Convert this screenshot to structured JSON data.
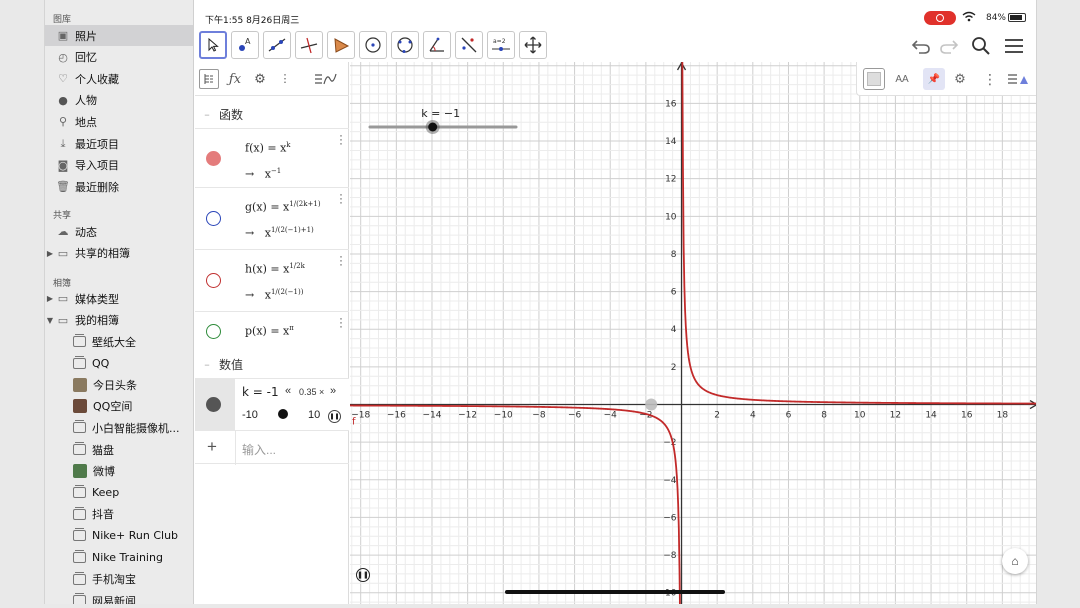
{
  "sidebar": {
    "sections": [
      {
        "title": "图库",
        "items": [
          {
            "label": "照片",
            "icon": "photos-icon",
            "active": true
          },
          {
            "label": "回忆",
            "icon": "memories-icon"
          },
          {
            "label": "个人收藏",
            "icon": "heart-icon"
          },
          {
            "label": "人物",
            "icon": "person-icon"
          },
          {
            "label": "地点",
            "icon": "pin-icon"
          },
          {
            "label": "最近项目",
            "icon": "recent-icon"
          },
          {
            "label": "导入项目",
            "icon": "import-icon"
          },
          {
            "label": "最近删除",
            "icon": "trash-icon"
          }
        ]
      },
      {
        "title": "共享",
        "items": [
          {
            "label": "动态",
            "icon": "cloud-icon"
          },
          {
            "label": "共享的相簿",
            "icon": "folder-icon",
            "expandable": true
          }
        ]
      },
      {
        "title": "相簿",
        "items": [
          {
            "label": "媒体类型",
            "icon": "folder-icon",
            "expandable": true
          },
          {
            "label": "我的相簿",
            "icon": "folder-icon",
            "expanded": true
          }
        ]
      }
    ],
    "albums": [
      {
        "label": "壁纸大全",
        "icon": "album-icon"
      },
      {
        "label": "QQ",
        "icon": "album-icon"
      },
      {
        "label": "今日头条",
        "icon": "album-thumb",
        "color": "#8a7a60"
      },
      {
        "label": "QQ空间",
        "icon": "album-thumb",
        "color": "#6b4a3a"
      },
      {
        "label": "小白智能摄像机...",
        "icon": "album-icon"
      },
      {
        "label": "猫盘",
        "icon": "album-icon"
      },
      {
        "label": "微博",
        "icon": "album-thumb",
        "color": "#4f7a4a"
      },
      {
        "label": "Keep",
        "icon": "album-icon"
      },
      {
        "label": "抖音",
        "icon": "album-icon"
      },
      {
        "label": "Nike+ Run Club",
        "icon": "album-icon"
      },
      {
        "label": "Nike Training",
        "icon": "album-icon"
      },
      {
        "label": "手机淘宝",
        "icon": "album-icon"
      },
      {
        "label": "网易新闻",
        "icon": "album-icon"
      }
    ]
  },
  "status": {
    "time": "下午1:55   8月26日周三",
    "battery": "84%",
    "battery_level": 0.84
  },
  "algebra": {
    "group_functions": "函数",
    "group_numbers": "数值",
    "input_placeholder": "输入...",
    "functions": [
      {
        "name": "f(x)",
        "def": "x",
        "def_sup": "k",
        "arrow": "→",
        "result": "x",
        "result_sup": "−1",
        "color": "#e06666",
        "filled": true
      },
      {
        "name": "g(x)",
        "def": "x",
        "def_sup": "1/(2k+1)",
        "arrow": "→",
        "result": "x",
        "result_sup": "1/(2(−1)+1)",
        "color": "#2a45b8",
        "filled": false
      },
      {
        "name": "h(x)",
        "def": "x",
        "def_sup": "1/2k",
        "arrow": "→",
        "result": "x",
        "result_sup": "1/(2(−1))",
        "color": "#c03030",
        "filled": false
      },
      {
        "name": "p(x)",
        "def": "x",
        "def_sup": "π",
        "color": "#2e8b3a",
        "filled": false
      }
    ],
    "slider": {
      "label": "k = -1",
      "speed": "0.35 ×",
      "min": "-10",
      "max": "10"
    }
  },
  "graph_slider_label": "k = −1",
  "chart_data": {
    "type": "line",
    "title": "",
    "xlabel": "",
    "ylabel": "",
    "xlim": [
      -18.6,
      20
    ],
    "ylim": [
      -10.6,
      18.2
    ],
    "x_ticks": [
      -18,
      -16,
      -14,
      -12,
      -10,
      -8,
      -6,
      -4,
      -2,
      2,
      4,
      6,
      8,
      10,
      12,
      14,
      16,
      18
    ],
    "y_ticks": [
      -10,
      -8,
      -6,
      -4,
      -2,
      2,
      4,
      6,
      8,
      10,
      12,
      14,
      16
    ],
    "grid": true,
    "series": [
      {
        "name": "f",
        "function": "x^-1",
        "color": "#c22a2a"
      }
    ],
    "slider": {
      "k": -1,
      "min": -10,
      "max": 10
    },
    "point": {
      "x": -1.7,
      "y": 0
    }
  }
}
